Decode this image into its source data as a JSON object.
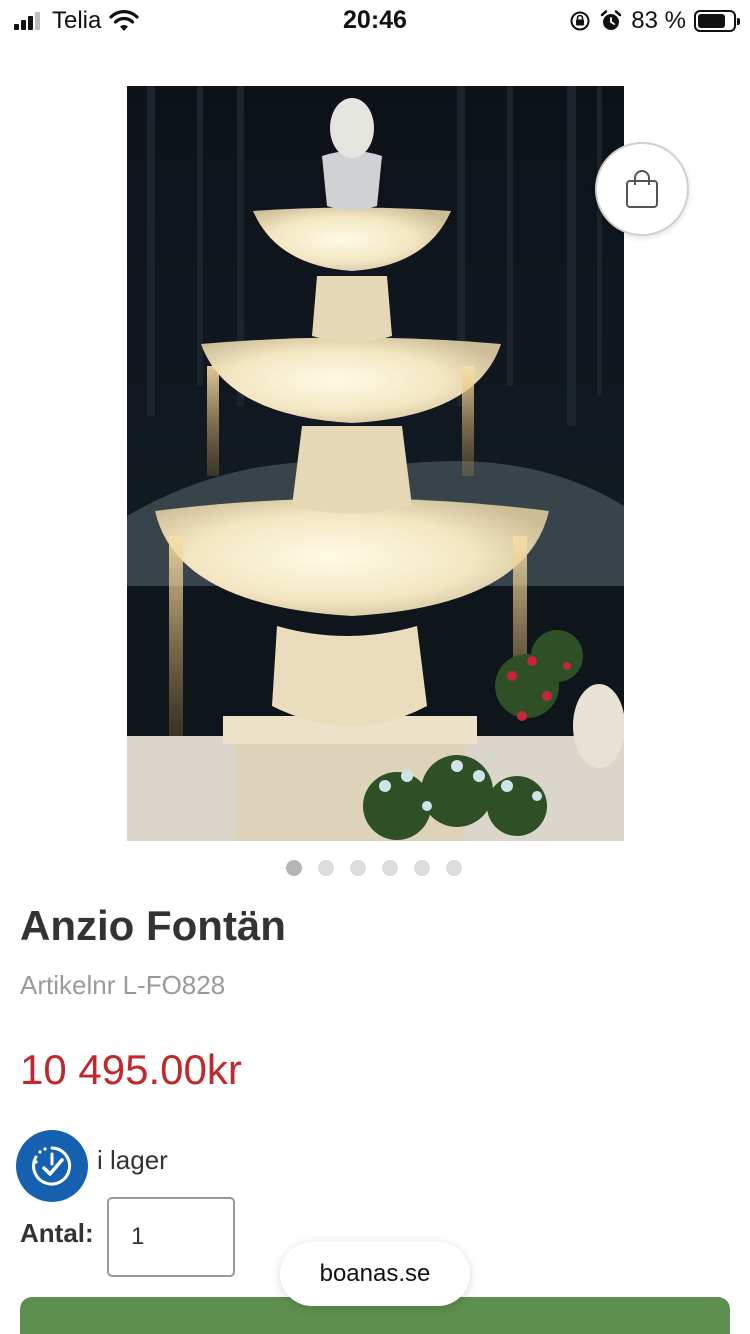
{
  "status_bar": {
    "carrier": "Telia",
    "time": "20:46",
    "battery_percent": "83 %",
    "battery_level": 0.83
  },
  "product": {
    "title": "Anzio Fontän",
    "article_number": "Artikelnr L-FO828",
    "price": "10 495.00kr",
    "stock_status": "i lager",
    "quantity_label": "Antal:",
    "quantity_value": "1",
    "image_count": 6,
    "active_image": 1
  },
  "browser": {
    "url": "boanas.se"
  },
  "colors": {
    "price": "#c0282d",
    "stock_icon_bg": "#1660b0",
    "add_to_cart_bar": "#5e8f4f"
  },
  "icons": {
    "cart": "shopping-bag-icon",
    "stock": "clock-check-icon"
  }
}
